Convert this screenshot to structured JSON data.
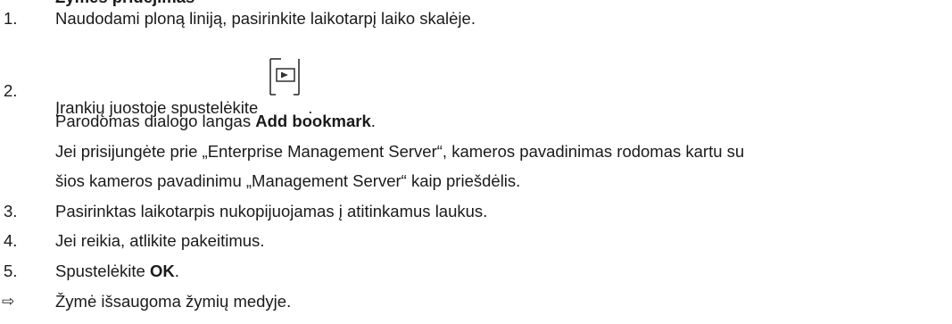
{
  "heading_partial": "Žymės pridėjimas",
  "steps": [
    {
      "num": "1.",
      "text": "Naudodami ploną liniją, pasirinkite laikotarpį laiko skalėje."
    },
    {
      "num": "2.",
      "text_before": "Įrankių juostoje spustelėkite",
      "text_after": "."
    },
    {
      "text_pre": "Parodomas dialogo langas ",
      "bold": "Add bookmark",
      "text_post": "."
    },
    {
      "text": "Jei prisijungėte prie „Enterprise Management Server“, kameros pavadinimas rodomas kartu su"
    },
    {
      "text": "šios kameros pavadinimu „Management Server“ kaip priešdėlis."
    },
    {
      "num": "3.",
      "text": "Pasirinktas laikotarpis nukopijuojamas į atitinkamus laukus."
    },
    {
      "num": "4.",
      "text": "Jei reikia, atlikite pakeitimus."
    },
    {
      "num": "5.",
      "text_pre": "Spustelėkite ",
      "bold": "OK",
      "text_post": "."
    }
  ],
  "result": {
    "mark": "⇨",
    "text": "Žymė išsaugoma žymių medyje."
  },
  "icons": {
    "toolbar": "add-bookmark-icon"
  }
}
